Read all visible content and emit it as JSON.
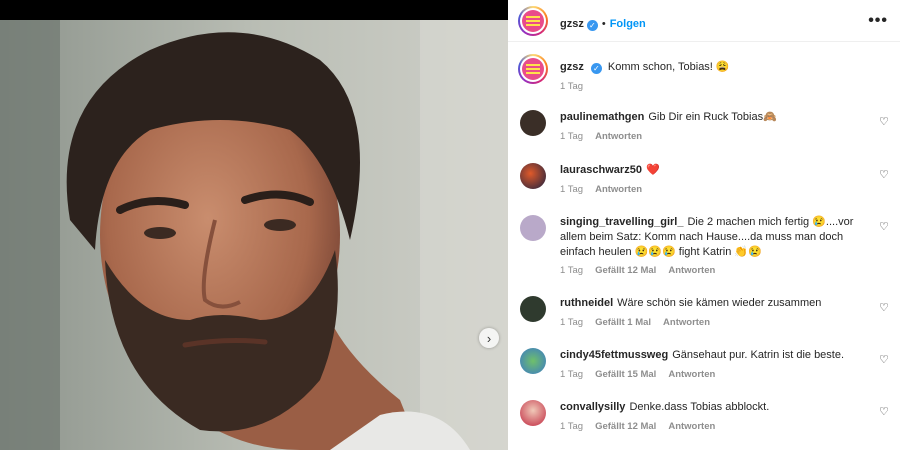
{
  "post": {
    "author": "gzsz",
    "follow_label": "Folgen",
    "more_label": "•••",
    "next_label": "›"
  },
  "caption": {
    "author": "gzsz",
    "text": "Komm schon, Tobias! 😩",
    "time": "1 Tag"
  },
  "comments": [
    {
      "user": "paulinemathgen",
      "text": "Gib Dir ein Ruck Tobias🙈",
      "time": "1 Tag",
      "likes": "",
      "reply": "Antworten"
    },
    {
      "user": "lauraschwarz50",
      "text": "❤️",
      "time": "1 Tag",
      "likes": "",
      "reply": "Antworten"
    },
    {
      "user": "singing_travelling_girl_",
      "text": "Die 2 machen mich fertig 😢....vor allem beim Satz: Komm nach Hause....da muss man doch einfach heulen 😢😢😢 fight Katrin 👏😢",
      "time": "1 Tag",
      "likes": "Gefällt 12 Mal",
      "reply": "Antworten"
    },
    {
      "user": "ruthneidel",
      "text": "Wäre schön sie kämen wieder zusammen",
      "time": "1 Tag",
      "likes": "Gefällt 1 Mal",
      "reply": "Antworten"
    },
    {
      "user": "cindy45fettmussweg",
      "text": "Gänsehaut pur. Katrin ist die beste.",
      "time": "1 Tag",
      "likes": "Gefällt 15 Mal",
      "reply": "Antworten"
    },
    {
      "user": "convallysilly",
      "text": "Denke.dass Tobias abblockt.",
      "time": "1 Tag",
      "likes": "Gefällt 12 Mal",
      "reply": "Antworten"
    }
  ],
  "colors": {
    "accent": "#0095f6",
    "verified": "#3897f0",
    "meta": "#8e8e8e"
  }
}
